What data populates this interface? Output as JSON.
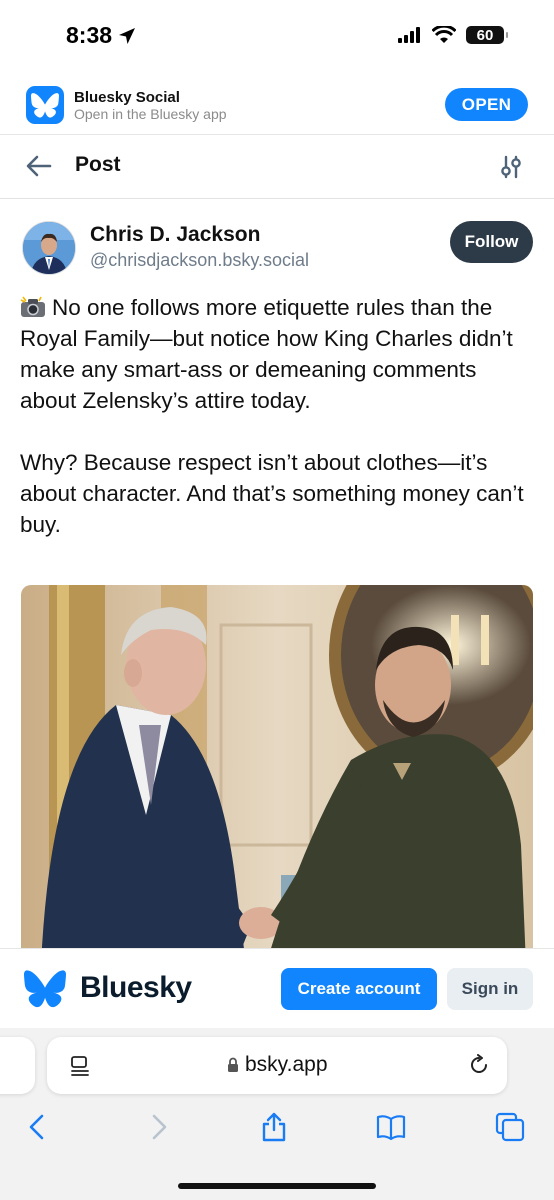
{
  "status_bar": {
    "time": "8:38",
    "battery": "60"
  },
  "app_banner": {
    "app_name": "Bluesky Social",
    "subtitle": "Open in the Bluesky app",
    "open_label": "OPEN"
  },
  "header": {
    "title": "Post"
  },
  "post": {
    "author_name": "Chris D. Jackson",
    "author_handle": "@chrisdjackson.bsky.social",
    "follow_label": "Follow",
    "paragraph_1": "No one follows more etiquette rules than the Royal Family—but notice how King Charles didn’t make any smart-ass or demeaning comments about Zelensky’s attire today.",
    "paragraph_2": "Why? Because respect isn’t about clothes—it’s about character. And that’s something money can’t buy."
  },
  "bottom_bar": {
    "logo_text": "Bluesky",
    "create_account_label": "Create account",
    "sign_in_label": "Sign in"
  },
  "browser": {
    "url": "bsky.app"
  },
  "colors": {
    "brand_blue": "#1185fe",
    "follow_bg": "#2d3a47",
    "ios_blue": "#1a7cf5"
  }
}
